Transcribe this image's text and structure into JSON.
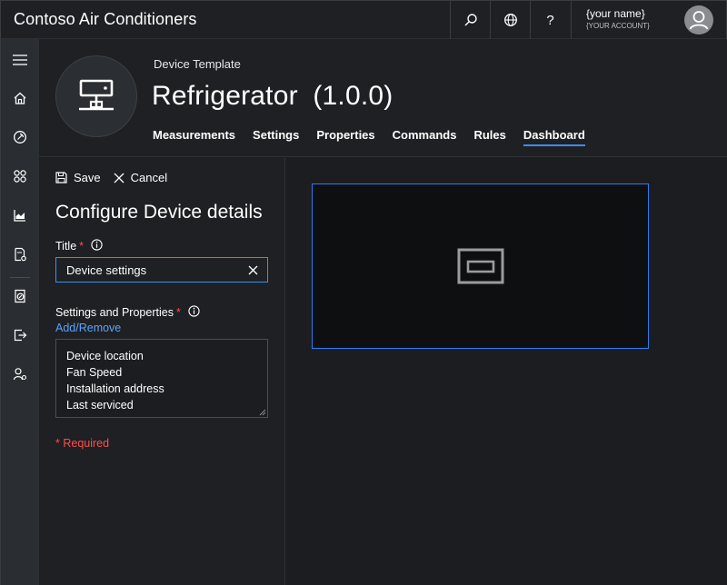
{
  "app": {
    "title": "Contoso Air Conditioners"
  },
  "topbar": {
    "icons": [
      "search-icon",
      "globe-icon",
      "help-icon"
    ],
    "help_glyph": "?",
    "user": {
      "name": "{your name}",
      "account": "{YOUR ACCOUNT}"
    }
  },
  "leftnav": {
    "items": [
      "hamburger-icon",
      "home-icon",
      "device-explorer-icon",
      "device-sets-icon",
      "analytics-icon",
      "device-templates-icon",
      "jobs-icon",
      "export-icon",
      "administration-icon"
    ]
  },
  "header": {
    "subtitle": "Device Template",
    "title": "Refrigerator",
    "version": "(1.0.0)",
    "tabs": [
      {
        "label": "Measurements",
        "active": false
      },
      {
        "label": "Settings",
        "active": false
      },
      {
        "label": "Properties",
        "active": false
      },
      {
        "label": "Commands",
        "active": false
      },
      {
        "label": "Rules",
        "active": false
      },
      {
        "label": "Dashboard",
        "active": true
      }
    ]
  },
  "panel": {
    "save_label": "Save",
    "cancel_label": "Cancel",
    "heading": "Configure Device details",
    "title_label": "Title",
    "required_mark": "*",
    "title_value": "Device settings",
    "settings_label": "Settings and Properties",
    "add_remove_label": "Add/Remove",
    "selected_items": [
      "Device location",
      "Fan Speed",
      "Installation address",
      "Last serviced"
    ],
    "required_note": "* Required"
  },
  "colors": {
    "accent": "#3a8ff5",
    "link": "#5aa4ff",
    "required": "#ff4d4d",
    "background": "#1b1d20"
  }
}
